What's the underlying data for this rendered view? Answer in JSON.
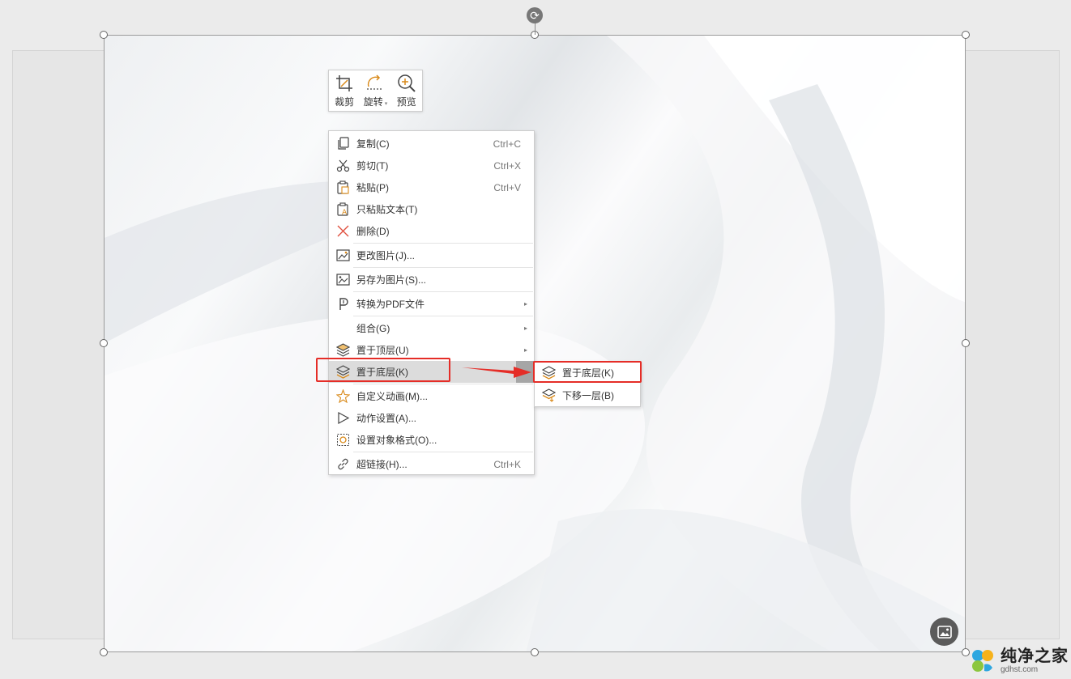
{
  "mini_toolbar": {
    "crop": "裁剪",
    "rotate": "旋转",
    "preview": "预览"
  },
  "context_menu": {
    "copy": {
      "label": "复制(C)",
      "shortcut": "Ctrl+C"
    },
    "cut": {
      "label": "剪切(T)",
      "shortcut": "Ctrl+X"
    },
    "paste": {
      "label": "粘贴(P)",
      "shortcut": "Ctrl+V"
    },
    "paste_text": {
      "label": "只粘贴文本(T)"
    },
    "delete": {
      "label": "删除(D)"
    },
    "change_picture": {
      "label": "更改图片(J)..."
    },
    "save_as_picture": {
      "label": "另存为图片(S)..."
    },
    "convert_pdf": {
      "label": "转换为PDF文件"
    },
    "group": {
      "label": "组合(G)"
    },
    "bring_to_front": {
      "label": "置于顶层(U)"
    },
    "send_to_back": {
      "label": "置于底层(K)"
    },
    "custom_animation": {
      "label": "自定义动画(M)..."
    },
    "action_settings": {
      "label": "动作设置(A)..."
    },
    "format_object": {
      "label": "设置对象格式(O)..."
    },
    "hyperlink": {
      "label": "超链接(H)...",
      "shortcut": "Ctrl+K"
    }
  },
  "submenu": {
    "send_to_back": "置于底层(K)",
    "send_backward": "下移一层(B)"
  },
  "watermark": {
    "title": "纯净之家",
    "url": "gdhst.com"
  },
  "colors": {
    "highlight_red": "#e52d27",
    "icon_orange": "#d98a1a",
    "active_row": "#dcdcdc"
  }
}
